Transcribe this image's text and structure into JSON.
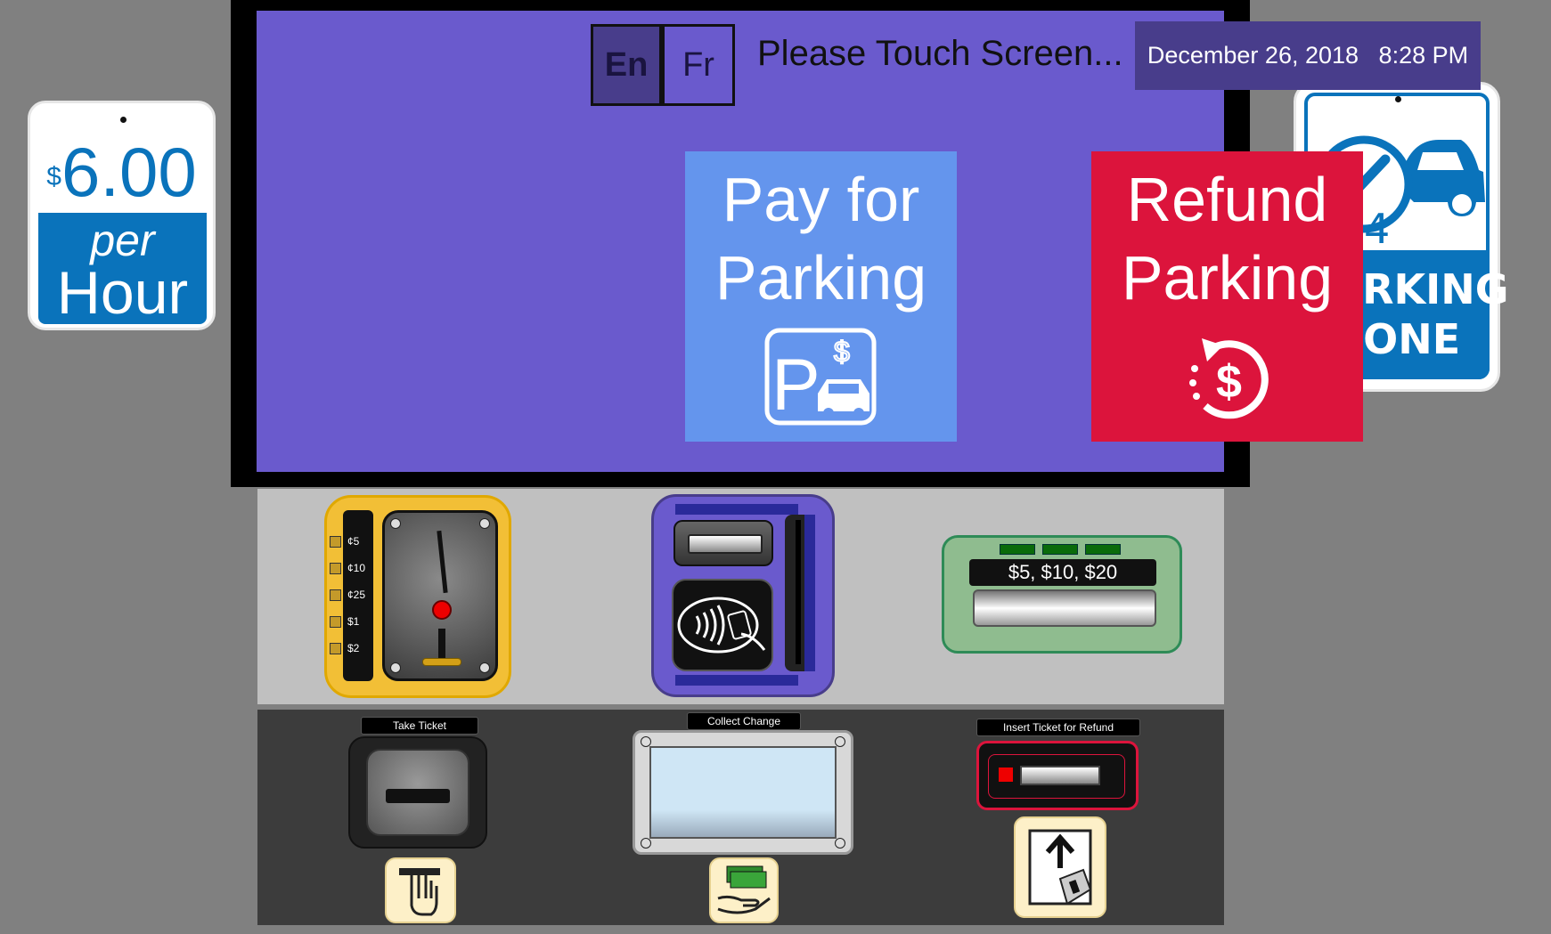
{
  "rate_sign": {
    "currency": "$",
    "amount": "6.00",
    "per": "per",
    "unit": "Hour",
    "colors": {
      "blue": "#0a73bb"
    }
  },
  "zone_sign": {
    "line1": "PARKING",
    "line2": "ZONE",
    "icon": "24h-parking-car-icon",
    "badge_number": "24"
  },
  "screen": {
    "languages": [
      {
        "code": "En",
        "active": true
      },
      {
        "code": "Fr",
        "active": false
      }
    ],
    "prompt": "Please Touch Screen...",
    "date": "December 26, 2018",
    "time": "8:28 PM",
    "buttons": {
      "pay": {
        "line1": "Pay for",
        "line2": "Parking",
        "icon": "parking-payment-icon",
        "color": "#6495ed"
      },
      "refund": {
        "line1": "Refund",
        "line2": "Parking",
        "icon": "refund-dollar-icon",
        "color": "#dc143c"
      }
    },
    "background": "#6a5acd"
  },
  "coin_acceptor": {
    "denominations": [
      "¢5",
      "¢10",
      "¢25",
      "$1",
      "$2"
    ]
  },
  "bill_acceptor": {
    "label": "$5,  $10,  $20"
  },
  "lower_panel": {
    "take_ticket": "Take Ticket",
    "collect_change": "Collect Change",
    "insert_refund": "Insert Ticket for Refund"
  }
}
